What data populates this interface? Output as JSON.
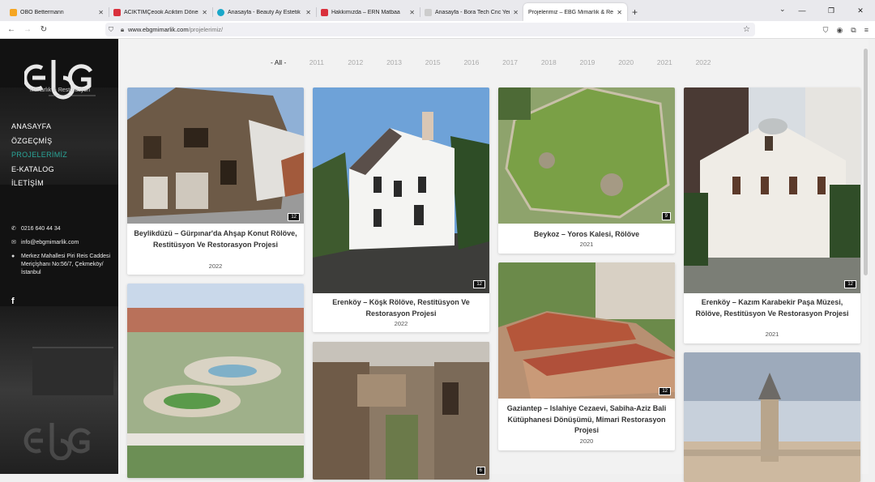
{
  "browser": {
    "tabs": [
      {
        "label": "OBO Bettermann",
        "favicon_color": "#f5a623",
        "active": false
      },
      {
        "label": "ACIKTIMÇeook Aciktim Döner",
        "favicon_color": "#d9303c",
        "active": false
      },
      {
        "label": "Anasayfa - Beauty Ay Estetik",
        "favicon_color": "#1aa7c9",
        "active": false
      },
      {
        "label": "Hakkımızda – ERN Matbaa",
        "favicon_color": "#d9303c",
        "active": false
      },
      {
        "label": "Anasayfa - Bora Tech Cnc Yeni",
        "favicon_color": "#cccccc",
        "active": false
      },
      {
        "label": "Projelerimiz – EBG Mimarlık & Rest",
        "favicon_color": "#eeeeee",
        "active": true
      }
    ],
    "new_tab": "+",
    "url_host": "www.ebgmimarlik.com",
    "url_path": "/projelerimiz/"
  },
  "sidebar": {
    "logo_text": "ebg",
    "logo_subtitle": "Mimarlık & Restorasyon",
    "menu": [
      {
        "label": "ANASAYFA",
        "active": false
      },
      {
        "label": "ÖZGEÇMİŞ",
        "active": false
      },
      {
        "label": "PROJELERİMİZ",
        "active": true
      },
      {
        "label": "E-KATALOG",
        "active": false
      },
      {
        "label": "İLETİŞİM",
        "active": false
      }
    ],
    "phone": "0216 640 44 34",
    "email": "info@ebgmimarlik.com",
    "address": "Merkez Mahallesi Piri Reis Caddesi Meriçİşhanı No:56/7, Çekmeköy/İstanbul",
    "social": "f",
    "accent_color": "#2aa79a"
  },
  "filters": [
    {
      "label": "- All -",
      "active": true
    },
    {
      "label": "2011",
      "active": false
    },
    {
      "label": "2012",
      "active": false
    },
    {
      "label": "2013",
      "active": false
    },
    {
      "label": "2015",
      "active": false
    },
    {
      "label": "2016",
      "active": false
    },
    {
      "label": "2017",
      "active": false
    },
    {
      "label": "2018",
      "active": false
    },
    {
      "label": "2019",
      "active": false
    },
    {
      "label": "2020",
      "active": false
    },
    {
      "label": "2021",
      "active": false
    },
    {
      "label": "2022",
      "active": false
    }
  ],
  "projects": [
    {
      "title": "Beylikdüzü – Gürpınar'da Ahşap Konut Rölöve, Restitüsyon Ve Restorasyon Projesi",
      "year": "2022",
      "photos": "12"
    },
    {
      "title": "",
      "year": "",
      "photos": ""
    },
    {
      "title": "Erenköy – Köşk Rölöve, Restitüsyon Ve Restorasyon Projesi",
      "year": "2022",
      "photos": "12"
    },
    {
      "title": "",
      "year": "",
      "photos": "6"
    },
    {
      "title": "Beykoz – Yoros Kalesi, Rölöve",
      "year": "2021",
      "photos": "9"
    },
    {
      "title": "Gaziantep – Islahiye Cezaevi, Sabiha-Aziz Bali Kütüphanesi Dönüşümü, Mimari Restorasyon Projesi",
      "year": "2020",
      "photos": "12"
    },
    {
      "title": "Erenköy – Kazım Karabekir Paşa Müzesi, Rölöve, Restitüsyon Ve Restorasyon Projesi",
      "year": "2021",
      "photos": "12"
    },
    {
      "title": "",
      "year": "",
      "photos": ""
    }
  ]
}
